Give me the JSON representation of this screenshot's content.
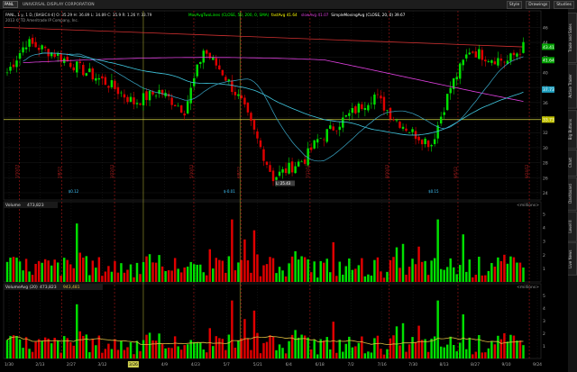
{
  "toolbar": {
    "symbol": "PANL",
    "company": "UNIVERSAL DISPLAY CORPORATION",
    "buttons": [
      "Style",
      "Drawings",
      "Studies"
    ]
  },
  "sidebar_tabs": [
    "Trade and Sales",
    "Active Trader",
    "Big Buttons",
    "Chart",
    "Dashboard",
    "Level II",
    "Live News"
  ],
  "colors": {
    "background": "#000000",
    "up_candle": "#00e000",
    "down_candle": "#e00000",
    "sma50": "#40c8e0",
    "sma200": "#e040e0",
    "sma20": "#40c8e0",
    "trendline": "#d03030",
    "price_line": "#d0d040",
    "volume_avg": "#e0c040"
  },
  "price_pane": {
    "header": "PANL, 1 y, 1 D, [BASIC4-4] O: 35.29 H: 36.89 L: 34.89 C: 35.9 R: 1.26 Y: 33.79",
    "studies": [
      {
        "label": "MovAvgTwoLines (CLOSE, 50, 200, 0, SMA)",
        "color": "#00ff00"
      },
      {
        "label": "fastAvg 41.64",
        "color": "#ffff00"
      },
      {
        "label": "slowAvg 41.07",
        "color": "#e040e0"
      },
      {
        "label": "SimpleMovingAvg (CLOSE, 20, 0) 39.67",
        "color": "#ffffff"
      }
    ],
    "copyright": "2013 © TD Ameritrade IP Company, Inc.",
    "y_ticks": [
      "46",
      "44",
      "42",
      "40",
      "38",
      "36",
      "34",
      "32",
      "30",
      "28",
      "26",
      "24"
    ],
    "price_tags": [
      {
        "value": "43.41",
        "color": "#00a000"
      },
      {
        "value": "41.64",
        "color": "#00a000"
      },
      {
        "value": "37.73",
        "color": "#20a0c0"
      },
      {
        "value": "33.73",
        "color": "#c0c000"
      }
    ],
    "low_marker": "L: 25.43",
    "event_labels": [
      "1/10/12",
      "2/8/12",
      "3/22/12",
      "5/10/12",
      "6/8/12",
      "7/12/12",
      "8/10/12",
      "9/5/12",
      "9/24/12"
    ],
    "earnings_labels": [
      "$0.12",
      "$-0.01",
      "$0.15"
    ]
  },
  "volume_pane": {
    "header": "Volume",
    "value": "473,823",
    "units": "<millions>",
    "y_ticks": [
      "5",
      "4",
      "3",
      "2",
      "1"
    ]
  },
  "volavg_pane": {
    "header": "VolumeAvg (20)",
    "value1": "473,823",
    "value2": "943,481",
    "units": "<millions>",
    "y_ticks": [
      "5",
      "4",
      "3",
      "2",
      "1"
    ]
  },
  "x_axis": {
    "labels": [
      "1/30",
      "2/13",
      "2/27",
      "3/12",
      "3/26",
      "4/9",
      "4/23",
      "5/7",
      "5/21",
      "6/4",
      "6/18",
      "7/2",
      "7/16",
      "7/30",
      "8/13",
      "8/27",
      "9/10",
      "9/24"
    ],
    "highlight": "3/26"
  },
  "chart_data": {
    "type": "candlestick",
    "x_labels": [
      "1/30",
      "2/13",
      "2/27",
      "3/12",
      "3/26",
      "4/9",
      "4/23",
      "5/7",
      "5/21",
      "6/4",
      "6/18",
      "7/2",
      "7/16",
      "7/30",
      "8/13",
      "8/27",
      "9/10",
      "9/24"
    ],
    "ylim": [
      24,
      47
    ],
    "sessions": 164,
    "close_keypoints": [
      [
        0,
        40
      ],
      [
        6,
        44
      ],
      [
        15,
        42.5
      ],
      [
        25,
        40
      ],
      [
        32,
        38.5
      ],
      [
        40,
        36
      ],
      [
        48,
        37.5
      ],
      [
        56,
        35
      ],
      [
        62,
        43
      ],
      [
        68,
        40
      ],
      [
        74,
        36
      ],
      [
        80,
        30
      ],
      [
        84,
        26
      ],
      [
        88,
        27
      ],
      [
        94,
        28.5
      ],
      [
        98,
        31
      ],
      [
        104,
        33
      ],
      [
        110,
        35
      ],
      [
        116,
        37
      ],
      [
        122,
        34
      ],
      [
        128,
        32
      ],
      [
        134,
        30.5
      ],
      [
        140,
        38
      ],
      [
        146,
        43
      ],
      [
        152,
        42
      ],
      [
        158,
        41.5
      ],
      [
        163,
        43.4
      ]
    ],
    "volume_ylim": [
      0,
      5.5
    ],
    "volume_spikes": [
      [
        22,
        4.3
      ],
      [
        71,
        4.6
      ],
      [
        78,
        3.8
      ],
      [
        130,
        2.6
      ],
      [
        136,
        4.6
      ],
      [
        144,
        3.5
      ]
    ]
  }
}
